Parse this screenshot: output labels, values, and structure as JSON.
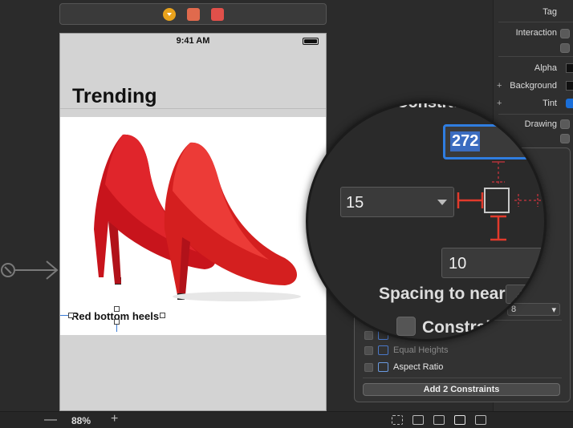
{
  "app": {
    "scene_dock_icons": [
      "view-controller-icon",
      "first-responder-icon",
      "exit-icon"
    ]
  },
  "device": {
    "status_time": "9:41 AM",
    "nav_title": "Trending",
    "product_label": "Red bottom heels"
  },
  "toolbar": {
    "zoom_out": "—",
    "zoom_level": "88%",
    "zoom_in": "+"
  },
  "inspector": {
    "tag_label": "Tag",
    "interaction_label": "Interaction",
    "alpha_label": "Alpha",
    "background_label": "Background",
    "tint_label": "Tint",
    "drawing_label": "Drawing",
    "plus": "+"
  },
  "constraints_popover": {
    "equal_heights_label": "Equal Heights",
    "aspect_ratio_label": "Aspect Ratio",
    "add_button_label": "Add 2 Constraints",
    "select_value": "8"
  },
  "magnifier": {
    "header_text": "Constrain",
    "top_value": "272",
    "leading_value": "15",
    "bottom_value": "10",
    "spacing_text": "Spacing to nearest",
    "constrain_margins_text": "Constrain"
  },
  "colors": {
    "accent": "#2f7de0",
    "constraint_red": "#e23a2c",
    "shoe_red": "#d41f1f"
  }
}
